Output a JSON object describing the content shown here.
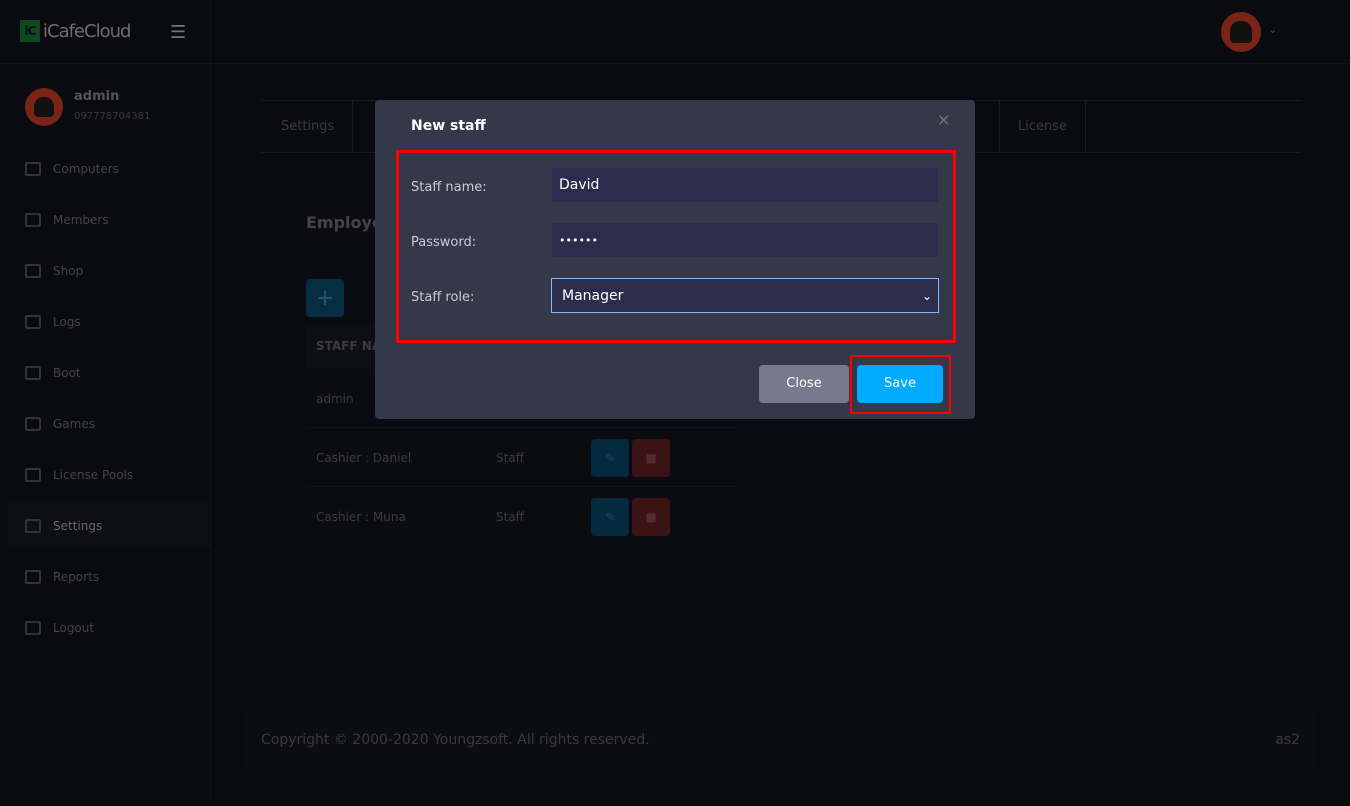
{
  "app": {
    "logo_text": "iCafeCloud",
    "logo_mark": "iC"
  },
  "user": {
    "name": "admin",
    "phone": "097778704381"
  },
  "sidebar": {
    "items": [
      {
        "label": "Computers",
        "icon": "monitor-icon"
      },
      {
        "label": "Members",
        "icon": "users-icon"
      },
      {
        "label": "Shop",
        "icon": "cart-icon"
      },
      {
        "label": "Logs",
        "icon": "calendar-icon"
      },
      {
        "label": "Boot",
        "icon": "windows-icon"
      },
      {
        "label": "Games",
        "icon": "gamepad-icon"
      },
      {
        "label": "License Pools",
        "icon": "badge-icon"
      },
      {
        "label": "Settings",
        "icon": "settings-icon"
      },
      {
        "label": "Reports",
        "icon": "badge-icon"
      },
      {
        "label": "Logout",
        "icon": "logout-icon"
      }
    ]
  },
  "tabs": [
    "Settings",
    "License"
  ],
  "employees": {
    "title": "Employe",
    "header": "STAFF NA",
    "rows": [
      {
        "name": "admin",
        "role": ""
      },
      {
        "name": "Cashier : Daniel",
        "role": "Staff"
      },
      {
        "name": "Cashier : Muna",
        "role": "Staff"
      }
    ]
  },
  "footer": {
    "copyright": "Copyright © 2000-2020 Youngzsoft. All rights reserved.",
    "server": "as2"
  },
  "modal": {
    "title": "New staff",
    "close_x": "×",
    "fields": {
      "name_label": "Staff name:",
      "name_value": "David",
      "password_label": "Password:",
      "password_value": "••••••",
      "role_label": "Staff role:",
      "role_value": "Manager"
    },
    "close_label": "Close",
    "save_label": "Save"
  },
  "colors": {
    "save": "#00aaff",
    "highlight": "#ff0000"
  }
}
